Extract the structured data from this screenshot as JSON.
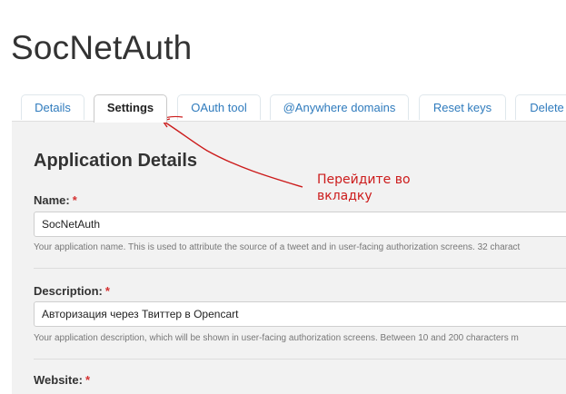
{
  "app_title": "SocNetAuth",
  "tabs": [
    {
      "label": "Details"
    },
    {
      "label": "Settings"
    },
    {
      "label": "OAuth tool"
    },
    {
      "label": "@Anywhere domains"
    },
    {
      "label": "Reset keys"
    },
    {
      "label": "Delete"
    }
  ],
  "section_title": "Application Details",
  "fields": {
    "name": {
      "label": "Name:",
      "required": "*",
      "value": "SocNetAuth",
      "help": "Your application name. This is used to attribute the source of a tweet and in user-facing authorization screens. 32 charact"
    },
    "description": {
      "label": "Description:",
      "required": "*",
      "value": "Авторизация через Твиттер в Opencart",
      "help": "Your application description, which will be shown in user-facing authorization screens. Between 10 and 200 characters m"
    },
    "website": {
      "label": "Website:",
      "required": "*"
    }
  },
  "annotation": {
    "line1": "Перейдите во",
    "line2": "вкладку",
    "color": "#cc1b1b"
  }
}
